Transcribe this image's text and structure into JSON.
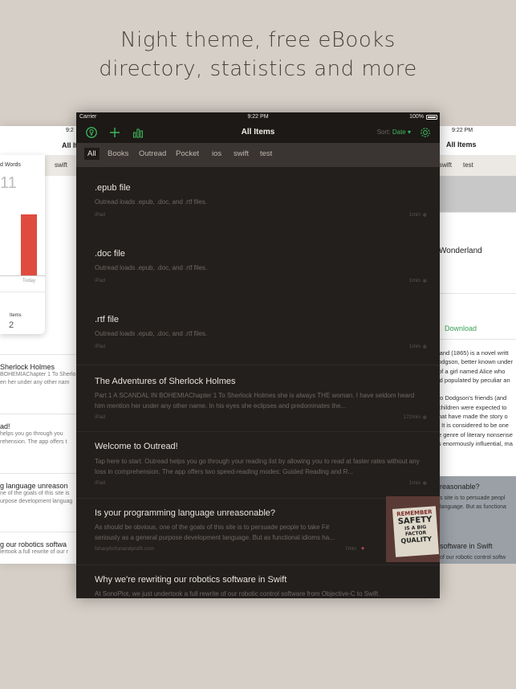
{
  "headline": {
    "line1": "Night theme, free eBooks",
    "line2": "directory, statistics and more"
  },
  "left_screen": {
    "status_time": "9:2",
    "title": "All It",
    "tab": "swift",
    "stats": {
      "label": "d Words",
      "number": "11",
      "today_label": "Today",
      "items_label": "Items",
      "items_value": "2",
      "bar_level": 0.85
    },
    "items": [
      {
        "title": "Sherlock Holmes",
        "line1": "BOHEMIAChapter 1 To Sherlo",
        "line2": "en her under any other nam"
      },
      {
        "title": "ad!",
        "line1": "helps you go through you",
        "line2": "rehension. The app offers t"
      },
      {
        "title": "g language unreason",
        "line1": "ne of the goals of this site is",
        "line2": "urpose development languag"
      },
      {
        "title": "g our robotics softwa",
        "line1": "lertook a full rewrite of our r",
        "line2": ""
      }
    ]
  },
  "right_screen": {
    "status_time": "9:22 PM",
    "title": "All Items",
    "tabs": [
      "swift",
      "test"
    ],
    "book_title": "Wonderland",
    "download_label": "Download",
    "body_lines": [
      "land (1865) is a novel writt",
      "odgson, better known under",
      "of a girl named Alice who",
      "ld populated by peculiar an",
      "",
      "to Dodgson's friends (and",
      "children were expected to",
      "hat have made the story o",
      ". It is considered to be one",
      "e genre of literary nonsense",
      "s enormously influential, ma"
    ],
    "item1_title": "reasonable?",
    "item1_line1": "s site is to persuade peopl",
    "item1_line2": "language. But as functiona",
    "item2_title": "software in Swift",
    "item2_line1": "of our robotic control softw"
  },
  "status_bar": {
    "carrier": "Carrier",
    "time": "9:22 PM",
    "battery": "100%"
  },
  "nav": {
    "title": "All Items",
    "sort_label": "Sort:",
    "sort_value": "Date ▾"
  },
  "tabs": [
    "All",
    "Books",
    "Outread",
    "Pocket",
    "ios",
    "swift",
    "test"
  ],
  "items": [
    {
      "title": ".epub file",
      "desc": "Outread loads .epub, .doc, and .rtf files.",
      "source": "iPad",
      "time": "1min"
    },
    {
      "title": ".doc file",
      "desc": "Outread loads .epub, .doc, and .rtf files.",
      "source": "iPad",
      "time": "1min"
    },
    {
      "title": ".rtf file",
      "desc": "Outread loads .epub, .doc, and .rtf files.",
      "source": "iPad",
      "time": "1min"
    },
    {
      "title": "The Adventures of Sherlock Holmes",
      "desc": "Part 1 A SCANDAL IN BOHEMIAChapter 1 To Sherlock Holmes she is always THE woman. I have seldom heard him mention her under any other name. In his eyes she eclipses and predominates the...",
      "source": "iPad",
      "time": "172min"
    },
    {
      "title": "Welcome to Outread!",
      "desc": "Tap here to start. Outread helps you go through your reading list by allowing you to read at faster rates without any loss in comprehension. The app offers two speed-reading modes: Guided Reading and R...",
      "source": "iPad",
      "time": "1min"
    },
    {
      "title": "Is your programming language unreasonable?",
      "desc": "As should be obvious, one of the goals of this site is to persuade people to take F# seriously as a general purpose development language. But as functional idioms ha...",
      "source": "fsharpforfunandprofit.com",
      "time": "7min"
    },
    {
      "title": "Why we're rewriting our robotics software in Swift",
      "desc": "At SonoPlot, we just undertook a full rewrite of our robotic control software from Objective-C to Swift.",
      "source": "",
      "time": ""
    }
  ],
  "thumbnail": {
    "line1": "REMEMBER",
    "line2": "SAFETY",
    "line3": "IS A BIG FACTOR",
    "line4": "QUALITY"
  },
  "colors": {
    "accent": "#3fb85a",
    "background": "#d6cfc7",
    "dark_bg": "#231f1d",
    "bar_red": "#e04b3f"
  }
}
